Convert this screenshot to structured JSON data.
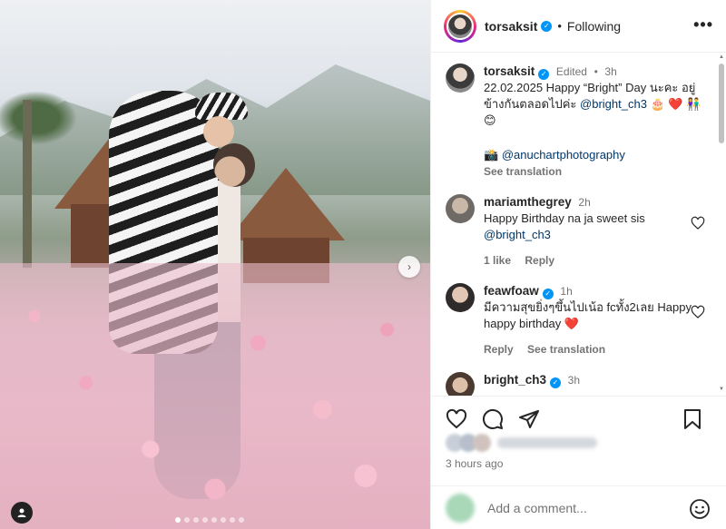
{
  "header": {
    "username": "torsaksit",
    "separator": "•",
    "follow_status": "Following",
    "more_label": "•••"
  },
  "caption": {
    "username": "torsaksit",
    "edited": "Edited",
    "dot": "•",
    "age": "3h",
    "text_line": "22.02.2025 Happy “Bright” Day นะคะ อยู่ข้างกันตลอดไปค่ะ ",
    "mention": "@bright_ch3",
    "emojis": " 🎂 ❤️ 👫 😊",
    "photo_credit_icon": "📸",
    "photo_credit": "@anuchartphotography",
    "see_translation": "See translation"
  },
  "comments": [
    {
      "username": "mariamthegrey",
      "age": "2h",
      "text": "Happy Birthday na ja sweet sis ",
      "mention": "@bright_ch3",
      "likes": "1 like",
      "reply": "Reply"
    },
    {
      "username": "feawfoaw",
      "age": "1h",
      "text": "มีความสุขยิ่งๆขึ้นไปเน้อ fcทั้ง2เลย Happy happy birthday ❤️",
      "reply": "Reply",
      "see_translation": "See translation"
    },
    {
      "username": "bright_ch3",
      "age": "3h"
    }
  ],
  "post": {
    "time_ago": "3 hours ago"
  },
  "composer": {
    "placeholder": "Add a comment..."
  },
  "carousel": {
    "next_label": "›",
    "slide_count": 8,
    "active_index": 0
  },
  "icons": {
    "verified": "verified-badge-icon",
    "like": "heart-icon",
    "comment": "comment-icon",
    "share": "share-icon",
    "save": "bookmark-icon",
    "emoji": "emoji-icon",
    "tagged": "person-tag-icon"
  },
  "colors": {
    "verified_blue": "#0095f6",
    "heart_red": "#ed4956",
    "muted_text": "#737373",
    "mention_blue": "#00376b"
  }
}
